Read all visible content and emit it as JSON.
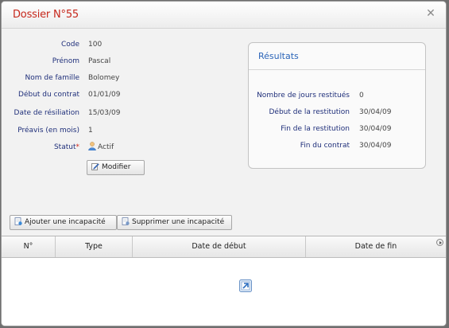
{
  "dialog": {
    "title": "Dossier N°55",
    "close_icon": "close-icon"
  },
  "form": {
    "fields": [
      {
        "label": "Code",
        "value": "100"
      },
      {
        "label": "Prénom",
        "value": "Pascal"
      },
      {
        "label": "Nom de famille",
        "value": "Bolomey"
      },
      {
        "label": "Début du contrat",
        "value": "01/01/09"
      },
      {
        "label": "Date de résiliation",
        "value": "15/03/09"
      },
      {
        "label": "Préavis (en mois)",
        "value": "1"
      }
    ],
    "status": {
      "label": "Statut",
      "required_mark": "*",
      "value": "Actif",
      "icon": "user-icon"
    },
    "modify_button": "Modifier"
  },
  "results": {
    "title": "Résultats",
    "rows": [
      {
        "label": "Nombre de jours restitués",
        "value": "0"
      },
      {
        "label": "Début de la restitution",
        "value": "30/04/09"
      },
      {
        "label": "Fin de la restitution",
        "value": "30/04/09"
      },
      {
        "label": "Fin du contrat",
        "value": "30/04/09"
      }
    ]
  },
  "toolbar": {
    "add_label": "Ajouter une incapacité",
    "remove_label": "Supprimer une incapacité"
  },
  "grid": {
    "columns": [
      "N°",
      "Type",
      "Date de début",
      "Date de fin"
    ]
  },
  "colors": {
    "title_red": "#c6271b",
    "label_blue": "#1f2f7a",
    "results_title_blue": "#2a64b8"
  }
}
